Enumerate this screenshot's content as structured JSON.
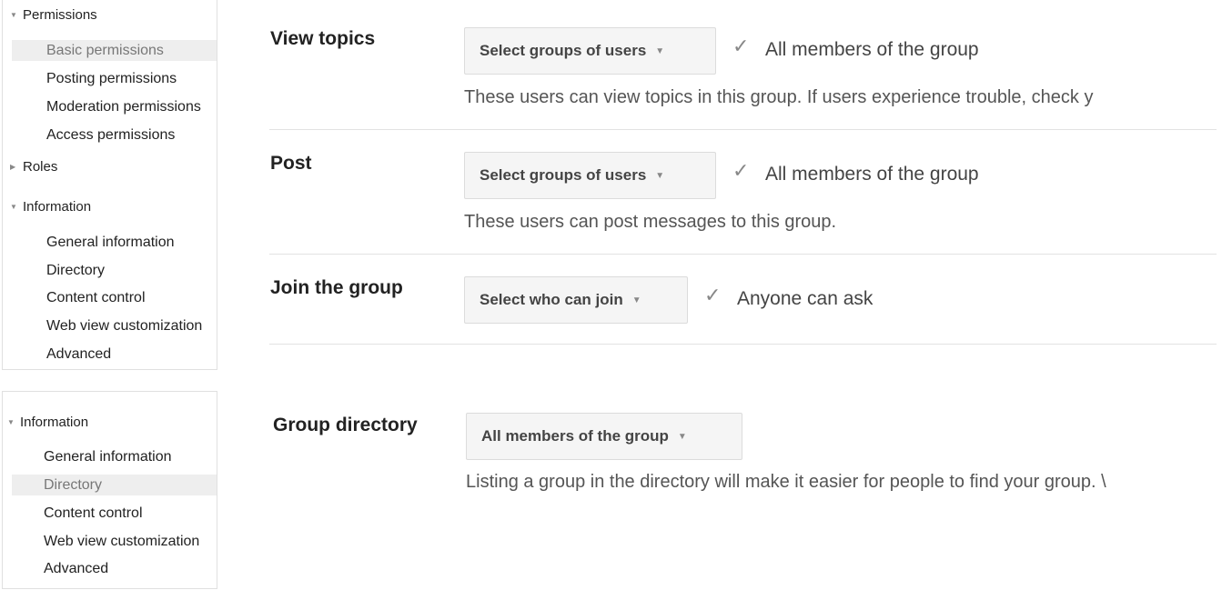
{
  "sidebar_top": {
    "permissions_header": "Permissions",
    "permissions_items": [
      "Basic permissions",
      "Posting permissions",
      "Moderation permissions",
      "Access permissions"
    ],
    "roles_header": "Roles",
    "information_header": "Information",
    "information_items": [
      "General information",
      "Directory",
      "Content control",
      "Web view customization",
      "Advanced"
    ]
  },
  "sidebar_bottom": {
    "information_header": "Information",
    "information_items": [
      "General information",
      "Directory",
      "Content control",
      "Web view customization",
      "Advanced"
    ]
  },
  "settings": {
    "view_topics": {
      "label": "View topics",
      "dropdown": "Select groups of users",
      "value": "All members of the group",
      "description": "These users can view topics in this group. If users experience trouble, check y"
    },
    "post": {
      "label": "Post",
      "dropdown": "Select groups of users",
      "value": "All members of the group",
      "description": "These users can post messages to this group."
    },
    "join": {
      "label": "Join the group",
      "dropdown": "Select who can join",
      "value": "Anyone can ask"
    },
    "directory": {
      "label": "Group directory",
      "dropdown": "All members of the group",
      "description": "Listing a group in the directory will make it easier for people to find your group. \\"
    }
  },
  "icons": {
    "expanded": "triangle-down-icon",
    "collapsed": "triangle-right-icon",
    "check": "check-icon",
    "caret": "caret-down-icon"
  },
  "colors": {
    "active_item_bg": "#eeeeee",
    "dropdown_bg": "#f5f5f5",
    "divider": "#e2e2e2"
  }
}
